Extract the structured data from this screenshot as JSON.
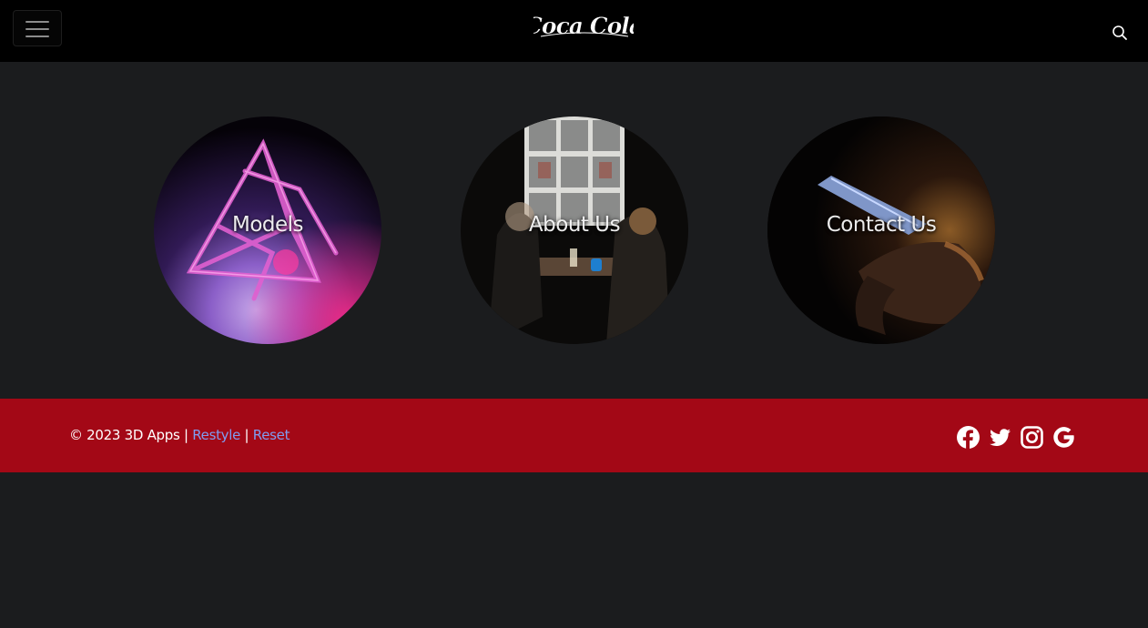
{
  "header": {
    "brand_logo": "Coca Cola",
    "menu_icon": "hamburger-menu-icon",
    "search_icon": "search-icon"
  },
  "cards": [
    {
      "label": "Models",
      "image": "pink-crystal-pyramid-sculpture"
    },
    {
      "label": "About Us",
      "image": "two-people-at-cafe-window"
    },
    {
      "label": "Contact Us",
      "image": "hand-holding-phone-in-dark"
    }
  ],
  "footer": {
    "copyright": "© 2023 3D Apps",
    "separator": "|",
    "links": [
      "Restyle",
      "Reset"
    ],
    "socials": [
      "facebook-icon",
      "twitter-icon",
      "instagram-icon",
      "google-icon"
    ]
  },
  "colors": {
    "nav_bg": "#000000",
    "page_bg": "#1b1c1e",
    "footer_bg": "#a30816",
    "link": "#7f9cf0"
  }
}
